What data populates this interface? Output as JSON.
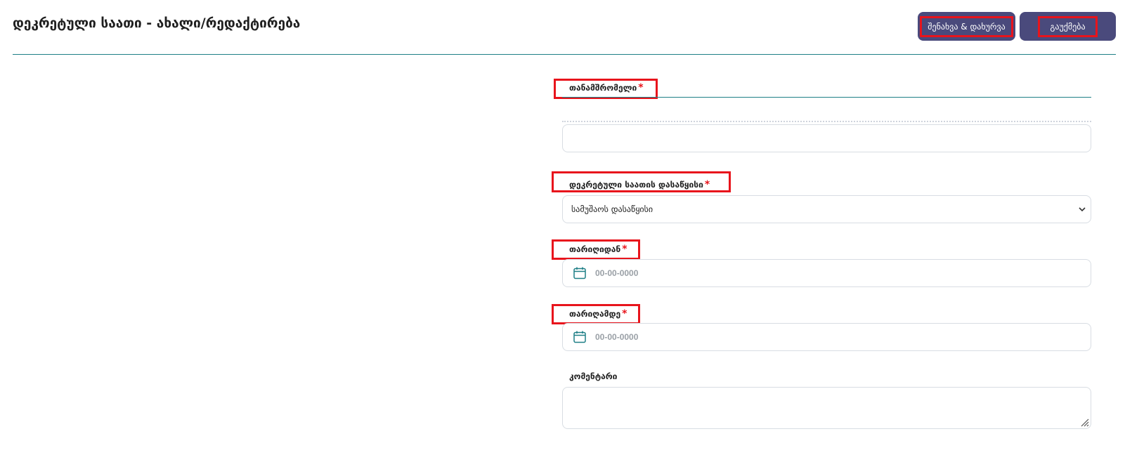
{
  "header": {
    "title": "დეკრეტული საათი - ახალი/რედაქტირება",
    "save_close_label": "შენახვა & დახურვა",
    "cancel_label": "გაუქმება"
  },
  "form": {
    "employee": {
      "label": "თანამშრომელი",
      "required_mark": "*",
      "value": ""
    },
    "start_of_hours": {
      "label": "დეკრეტული საათის დასაწყისი",
      "required_mark": "*",
      "selected": "სამუშაოს დასაწყისი"
    },
    "date_from": {
      "label": "თარიღიდან",
      "required_mark": "*",
      "placeholder": "00-00-0000",
      "icon": "calendar-icon"
    },
    "date_to": {
      "label": "თარიღამდე",
      "required_mark": "*",
      "placeholder": "00-00-0000",
      "icon": "calendar-icon"
    },
    "comment": {
      "label": "კომენტარი",
      "value": ""
    }
  },
  "colors": {
    "button_bg": "#4a4a7c",
    "accent_line": "#1e7f86",
    "required": "#e8141c",
    "highlight": "#e8141c",
    "icon": "#1e7f86"
  }
}
